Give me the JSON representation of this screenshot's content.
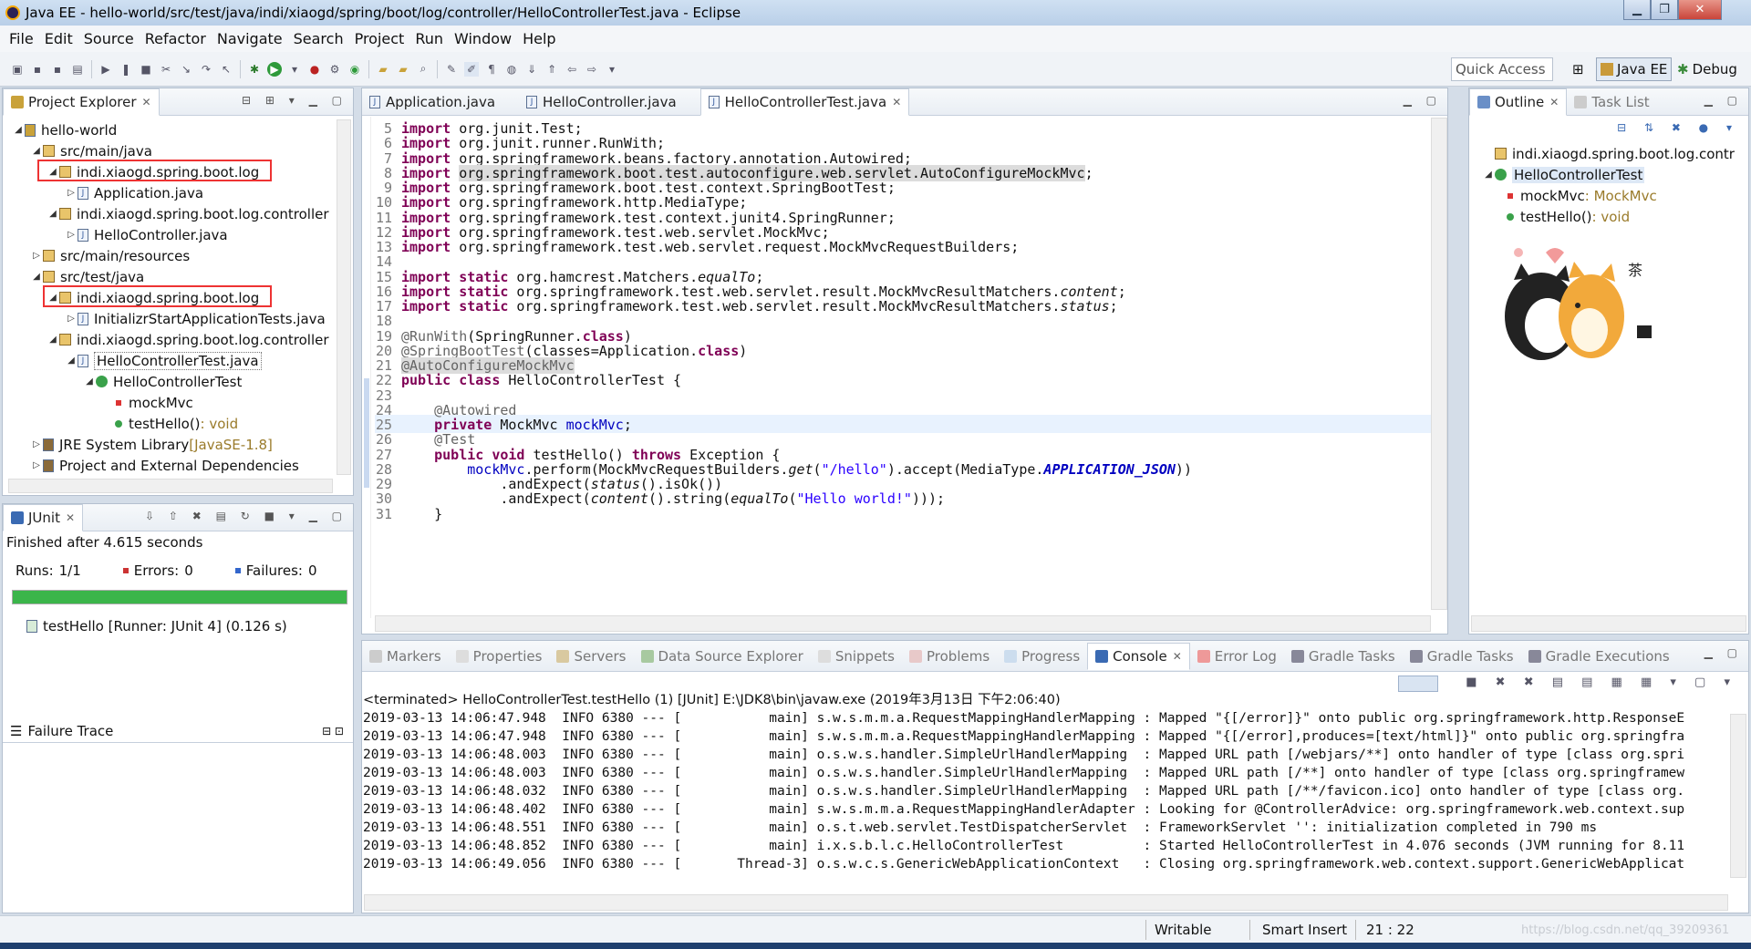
{
  "window": {
    "title": "Java EE - hello-world/src/test/java/indi/xiaogd/spring/boot/log/controller/HelloControllerTest.java - Eclipse"
  },
  "menu": [
    "File",
    "Edit",
    "Source",
    "Refactor",
    "Navigate",
    "Search",
    "Project",
    "Run",
    "Window",
    "Help"
  ],
  "toolbar": {
    "quick_access": "Quick Access",
    "perspective_javaee": "Java EE",
    "perspective_debug": "Debug"
  },
  "project_explorer": {
    "title": "Project Explorer",
    "items": [
      {
        "label": "hello-world"
      },
      {
        "label": "src/main/java"
      },
      {
        "label": "indi.xiaogd.spring.boot.log"
      },
      {
        "label": "Application.java"
      },
      {
        "label": "indi.xiaogd.spring.boot.log.controller"
      },
      {
        "label": "HelloController.java"
      },
      {
        "label": "src/main/resources"
      },
      {
        "label": "src/test/java"
      },
      {
        "label": "indi.xiaogd.spring.boot.log"
      },
      {
        "label": "InitializrStartApplicationTests.java"
      },
      {
        "label": "indi.xiaogd.spring.boot.log.controller"
      },
      {
        "label": "HelloControllerTest.java"
      },
      {
        "label": "HelloControllerTest"
      },
      {
        "label": "mockMvc"
      },
      {
        "label": "testHello()",
        "suffix": " : void"
      },
      {
        "label": "JRE System Library",
        "suffix": " [JavaSE-1.8]"
      },
      {
        "label": "Project and External Dependencies"
      }
    ]
  },
  "junit": {
    "title": "JUnit",
    "finished": "Finished after 4.615 seconds",
    "runs_label": "Runs:",
    "runs": "1/1",
    "errors_label": "Errors:",
    "errors": "0",
    "failures_label": "Failures:",
    "failures": "0",
    "progress": 1.0,
    "test_item": "testHello [Runner: JUnit 4] (0.126 s)",
    "failure_trace": "Failure Trace"
  },
  "editor": {
    "tabs": [
      "Application.java",
      "HelloController.java",
      "HelloControllerTest.java"
    ],
    "lines": [
      {
        "n": "5",
        "html": "<span class='kw'>import</span> org.junit.Test;"
      },
      {
        "n": "6",
        "html": "<span class='kw'>import</span> org.junit.runner.RunWith;"
      },
      {
        "n": "7",
        "html": "<span class='kw'>import</span> org.springframework.beans.factory.annotation.Autowired;"
      },
      {
        "n": "8",
        "html": "<span class='kw'>import</span> <span style='background:#dcdcdc'>org.springframework.boot.test.autoconfigure.web.servlet.AutoConfigureMockMvc</span>;"
      },
      {
        "n": "9",
        "html": "<span class='kw'>import</span> org.springframework.boot.test.context.SpringBootTest;"
      },
      {
        "n": "10",
        "html": "<span class='kw'>import</span> org.springframework.http.MediaType;"
      },
      {
        "n": "11",
        "html": "<span class='kw'>import</span> org.springframework.test.context.junit4.SpringRunner;"
      },
      {
        "n": "12",
        "html": "<span class='kw'>import</span> org.springframework.test.web.servlet.MockMvc;"
      },
      {
        "n": "13",
        "html": "<span class='kw'>import</span> org.springframework.test.web.servlet.request.MockMvcRequestBuilders;"
      },
      {
        "n": "14",
        "html": ""
      },
      {
        "n": "15",
        "html": "<span class='kw'>import static</span> org.hamcrest.Matchers.<span class='it'>equalTo</span>;"
      },
      {
        "n": "16",
        "html": "<span class='kw'>import static</span> org.springframework.test.web.servlet.result.MockMvcResultMatchers.<span class='it'>content</span>;"
      },
      {
        "n": "17",
        "html": "<span class='kw'>import static</span> org.springframework.test.web.servlet.result.MockMvcResultMatchers.<span class='it'>status</span>;"
      },
      {
        "n": "18",
        "html": ""
      },
      {
        "n": "19",
        "html": "<span class='an'>@RunWith</span>(SpringRunner.<span class='kw'>class</span>)"
      },
      {
        "n": "20",
        "html": "<span class='an'>@SpringBootTest</span>(classes=Application.<span class='kw'>class</span>)"
      },
      {
        "n": "21",
        "html": "<span class='an' style='background:#dcdcdc'>@AutoConfigureMockMvc</span>"
      },
      {
        "n": "22",
        "html": "<span class='kw'>public class</span> HelloControllerTest {"
      },
      {
        "n": "23",
        "html": ""
      },
      {
        "n": "24",
        "html": "    <span class='an'>@Autowired</span>"
      },
      {
        "n": "25",
        "html": "    <span class='kw'>private</span> MockMvc <span class='fi'>mockMvc</span>;"
      },
      {
        "n": "26",
        "html": "    <span class='an'>@Test</span>"
      },
      {
        "n": "27",
        "html": "    <span class='kw'>public void</span> testHello() <span class='kw'>throws</span> Exception {"
      },
      {
        "n": "28",
        "html": "        <span class='fi'>mockMvc</span>.perform(MockMvcRequestBuilders.<span class='it'>get</span>(<span class='st'>\"/hello\"</span>).accept(MediaType.<span class='fi it' style='font-weight:bold'>APPLICATION_JSON</span>))"
      },
      {
        "n": "29",
        "html": "            .andExpect(<span class='it'>status</span>().isOk())"
      },
      {
        "n": "30",
        "html": "            .andExpect(<span class='it'>content</span>().string(<span class='it'>equalTo</span>(<span class='st'>\"Hello world!\"</span>)));"
      },
      {
        "n": "31",
        "html": "    }"
      }
    ]
  },
  "outline": {
    "title": "Outline",
    "task_list": "Task List",
    "items": [
      {
        "label": "indi.xiaogd.spring.boot.log.contr"
      },
      {
        "label": "HelloControllerTest"
      },
      {
        "label": "mockMvc",
        "suffix": " : MockMvc"
      },
      {
        "label": "testHello()",
        "suffix": " : void"
      }
    ]
  },
  "bottom_tabs": [
    "Markers",
    "Properties",
    "Servers",
    "Data Source Explorer",
    "Snippets",
    "Problems",
    "Progress",
    "Console",
    "Error Log",
    "Gradle Tasks",
    "Gradle Tasks",
    "Gradle Executions"
  ],
  "console": {
    "header": "<terminated> HelloControllerTest.testHello (1) [JUnit] E:\\JDK8\\bin\\javaw.exe (2019年3月13日 下午2:06:40)",
    "lines": [
      "2019-03-13 14:06:47.948  INFO 6380 --- [           main] s.w.s.m.m.a.RequestMappingHandlerMapping : Mapped \"{[/error]}\" onto public org.springframework.http.ResponseE",
      "2019-03-13 14:06:47.948  INFO 6380 --- [           main] s.w.s.m.m.a.RequestMappingHandlerMapping : Mapped \"{[/error],produces=[text/html]}\" onto public org.springfra",
      "2019-03-13 14:06:48.003  INFO 6380 --- [           main] o.s.w.s.handler.SimpleUrlHandlerMapping  : Mapped URL path [/webjars/**] onto handler of type [class org.spri",
      "2019-03-13 14:06:48.003  INFO 6380 --- [           main] o.s.w.s.handler.SimpleUrlHandlerMapping  : Mapped URL path [/**] onto handler of type [class org.springframew",
      "2019-03-13 14:06:48.032  INFO 6380 --- [           main] o.s.w.s.handler.SimpleUrlHandlerMapping  : Mapped URL path [/**/favicon.ico] onto handler of type [class org.",
      "2019-03-13 14:06:48.402  INFO 6380 --- [           main] s.w.s.m.m.a.RequestMappingHandlerAdapter : Looking for @ControllerAdvice: org.springframework.web.context.sup",
      "2019-03-13 14:06:48.551  INFO 6380 --- [           main] o.s.t.web.servlet.TestDispatcherServlet  : FrameworkServlet '': initialization completed in 790 ms",
      "2019-03-13 14:06:48.852  INFO 6380 --- [           main] i.x.s.b.l.c.HelloControllerTest          : Started HelloControllerTest in 4.076 seconds (JVM running for 8.11",
      "2019-03-13 14:06:49.056  INFO 6380 --- [       Thread-3] o.s.w.c.s.GenericWebApplicationContext   : Closing org.springframework.web.context.support.GenericWebApplicat"
    ]
  },
  "status": {
    "mode": "Writable",
    "insert": "Smart Insert",
    "position": "21 : 22",
    "watermark": "https://blog.csdn.net/qq_39209361"
  },
  "colors": {
    "progress_green": "#3bb54a",
    "highlight_red": "#e33333",
    "keyword": "#7f0055"
  }
}
